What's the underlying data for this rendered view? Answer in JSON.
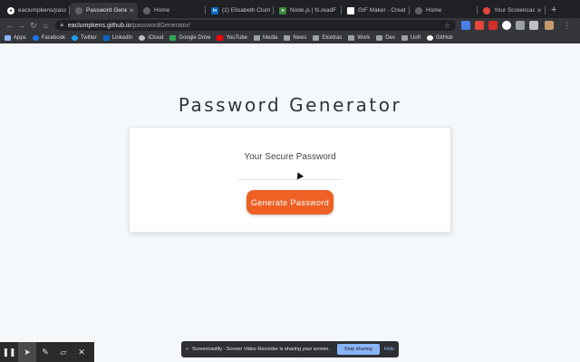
{
  "browser": {
    "tabs": [
      {
        "title": "eaclumpkens/pass",
        "icon": "github-icon",
        "color": "#ffffff",
        "glyph": ""
      },
      {
        "title": "Password Genera",
        "icon": "globe-icon",
        "color": "#5f6368",
        "glyph": "",
        "active": true
      },
      {
        "title": "Home",
        "icon": "globe-icon",
        "color": "#5f6368",
        "glyph": ""
      },
      {
        "title": "(1) Elisabeth Clum",
        "icon": "linkedin-icon",
        "color": "#0a66c2",
        "glyph": "in"
      },
      {
        "title": "Node.js | fs.readF",
        "icon": "node-icon",
        "color": "#3c873a",
        "glyph": "n"
      },
      {
        "title": "GIF Maker - Creat",
        "icon": "gif-icon",
        "color": "#ffffff",
        "glyph": ""
      },
      {
        "title": "Home",
        "icon": "globe-icon",
        "color": "#5f6368",
        "glyph": ""
      },
      {
        "title": "Your Screencastify",
        "icon": "screencastify-icon",
        "color": "#e8453c",
        "glyph": ""
      }
    ],
    "url_host": "eaclumpkens.github.io",
    "url_path": "/passwordGenerator/",
    "bookmarks": [
      {
        "label": "Apps",
        "icon": "apps-icon",
        "color": "#8ab4f8"
      },
      {
        "label": "Facebook",
        "icon": "facebook-icon",
        "color": "#1877f2"
      },
      {
        "label": "Twitter",
        "icon": "twitter-icon",
        "color": "#1da1f2"
      },
      {
        "label": "LinkedIn",
        "icon": "linkedin-icon",
        "color": "#0a66c2"
      },
      {
        "label": "iCloud",
        "icon": "apple-icon",
        "color": "#bdc1c6"
      },
      {
        "label": "Google Drive",
        "icon": "google-drive-icon",
        "color": "#34a853"
      },
      {
        "label": "YouTube",
        "icon": "youtube-icon",
        "color": "#ff0000"
      },
      {
        "label": "Media",
        "icon": "folder-icon",
        "color": "#9aa0a6"
      },
      {
        "label": "News",
        "icon": "folder-icon",
        "color": "#9aa0a6"
      },
      {
        "label": "Etcetras",
        "icon": "folder-icon",
        "color": "#9aa0a6"
      },
      {
        "label": "Work",
        "icon": "folder-icon",
        "color": "#9aa0a6"
      },
      {
        "label": "Dev",
        "icon": "folder-icon",
        "color": "#9aa0a6"
      },
      {
        "label": "UofI",
        "icon": "folder-icon",
        "color": "#9aa0a6"
      },
      {
        "label": "GitHub",
        "icon": "github-icon",
        "color": "#ffffff"
      }
    ]
  },
  "app": {
    "title": "Password Generator",
    "card_title": "Your Secure Password",
    "password_value": "",
    "generate_label": "Generate Password",
    "accent": "#ee6024"
  },
  "screencastify": {
    "banner_text": "Screencastify - Screen Video Recorder is sharing your screen.",
    "stop_label": "Stop sharing",
    "hide_label": "Hide"
  }
}
